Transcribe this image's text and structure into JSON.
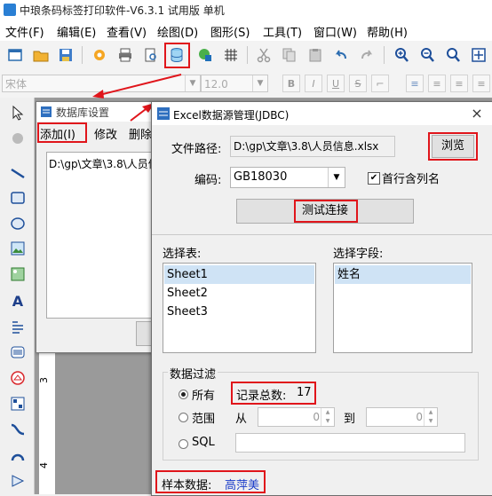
{
  "app": {
    "title": "中琅条码标签打印软件-V6.3.1 试用版 单机"
  },
  "menubar": [
    {
      "label": "文件(F)",
      "icon": ""
    },
    {
      "label": "编辑(E)",
      "icon": ""
    },
    {
      "label": "查看(V)",
      "icon": ""
    },
    {
      "label": "绘图(D)",
      "icon": ""
    },
    {
      "label": "图形(S)",
      "icon": ""
    },
    {
      "label": "工具(T)",
      "icon": ""
    },
    {
      "label": "窗口(W)",
      "icon": ""
    },
    {
      "label": "帮助(H)",
      "icon": ""
    }
  ],
  "formatbar": {
    "font_name": "宋体",
    "font_size": "12.0",
    "bold": "B",
    "italic": "I",
    "underline": "U",
    "strike": "S"
  },
  "db_dialog": {
    "title": "数据库设置",
    "menu_add": "添加(I)",
    "menu_modify": "修改",
    "menu_delete": "删除",
    "list_item": "D:\\gp\\文章\\3.8\\人员信息.xlsx"
  },
  "excel_dialog": {
    "title": "Excel数据源管理(JDBC)",
    "close": "×",
    "file_path_label": "文件路径:",
    "file_path_value": "D:\\gp\\文章\\3.8\\人员信息.xlsx",
    "browse_button": "浏览",
    "encoding_label": "编码:",
    "encoding_value": "GB18030",
    "first_row_header_label": "首行含列名",
    "first_row_header_checked": true,
    "test_connection_button": "测试连接",
    "select_table_label": "选择表:",
    "tables": [
      "Sheet1",
      "Sheet2",
      "Sheet3"
    ],
    "selected_table_index": 0,
    "select_field_label": "选择字段:",
    "fields": [
      "姓名"
    ],
    "filter_group_label": "数据过滤",
    "filter_all_label": "所有",
    "record_count_label": "记录总数:",
    "record_count_value": "17",
    "filter_range_label": "范围",
    "range_from_label": "从",
    "range_from_value": "0",
    "range_to_label": "到",
    "range_to_value": "0",
    "filter_sql_label": "SQL",
    "sample_data_label": "样本数据:",
    "sample_data_value": "高萍美"
  },
  "ruler": {
    "tick_3": "3",
    "tick_4": "4"
  },
  "colors": {
    "highlight_red": "#e0151b",
    "selection_blue": "#cfe3f5",
    "sample_value_blue": "#1a3cc9",
    "canvas_gray": "#9a9a9a"
  }
}
